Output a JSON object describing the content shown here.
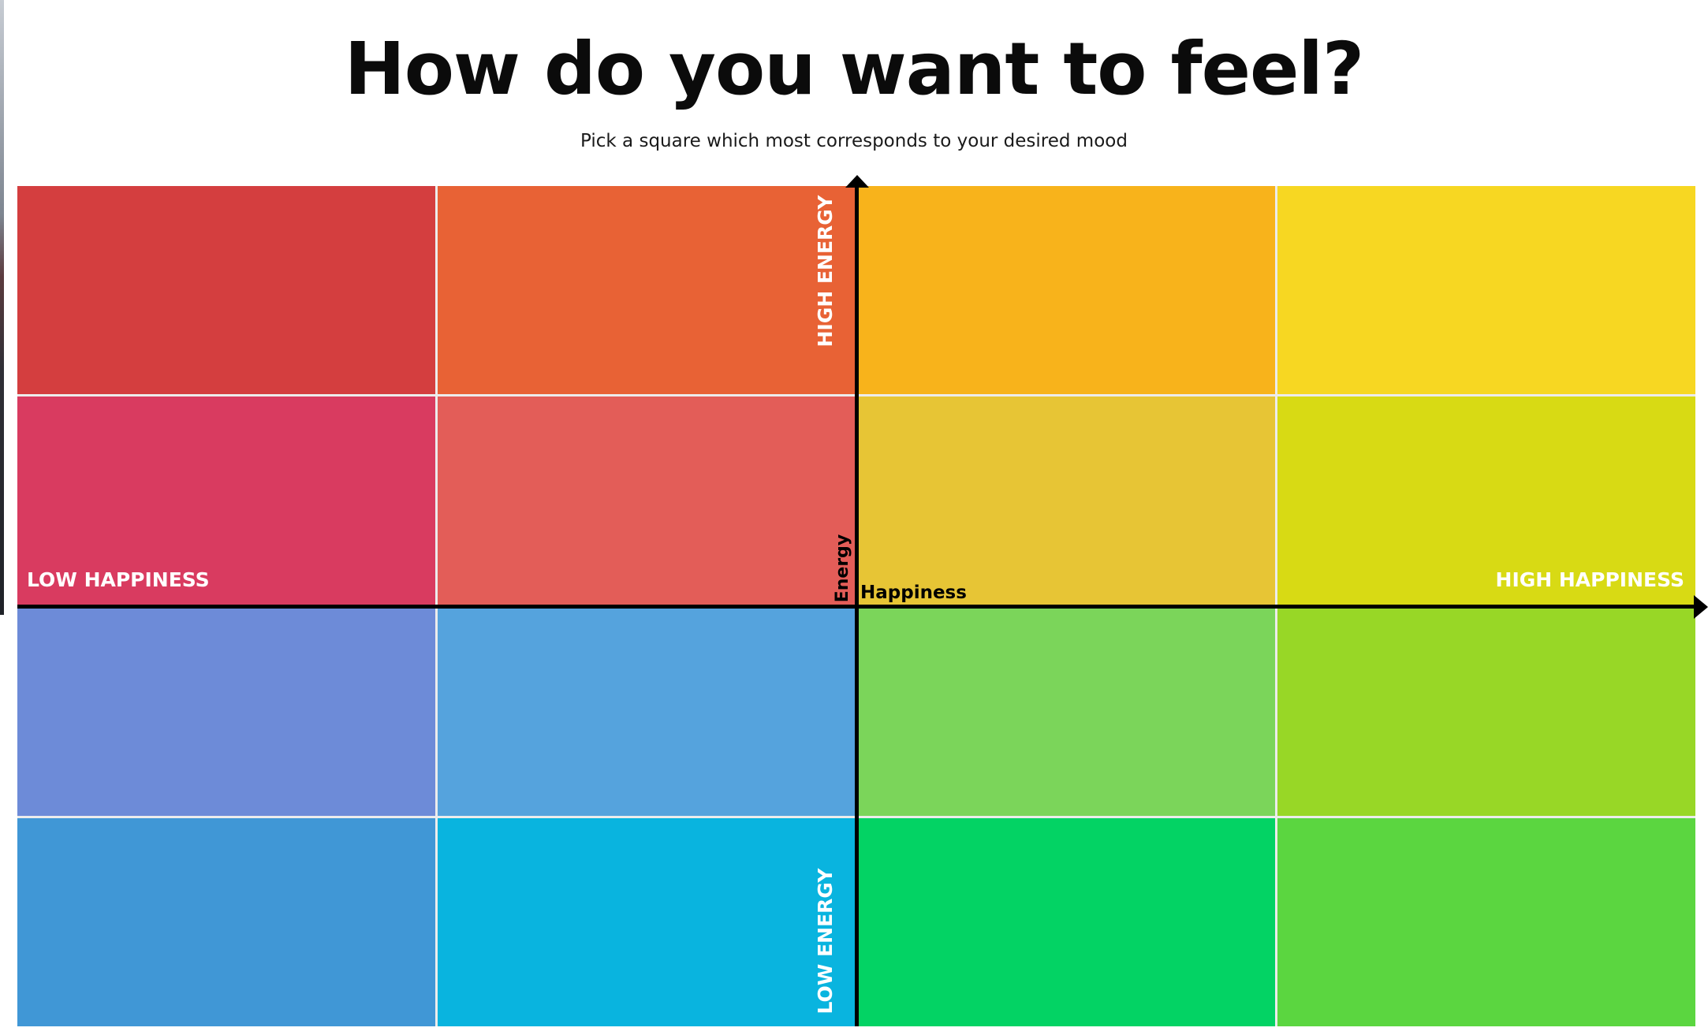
{
  "title": "How do you want to feel?",
  "subtitle": "Pick a square which most corresponds to your desired mood",
  "axes": {
    "horizontal_label": "Happiness",
    "vertical_label": "Energy",
    "low_happiness": "LOW HAPPINESS",
    "high_happiness": "HIGH HAPPINESS",
    "high_energy": "HIGH ENERGY",
    "low_energy": "LOW ENERGY",
    "axis_color": "#000000"
  },
  "grid": {
    "rows": 4,
    "columns": 4,
    "cells": [
      {
        "row": 1,
        "col": 1,
        "color": "#d43e3f"
      },
      {
        "row": 1,
        "col": 2,
        "color": "#e86235"
      },
      {
        "row": 1,
        "col": 3,
        "color": "#f8b31b"
      },
      {
        "row": 1,
        "col": 4,
        "color": "#f7d722"
      },
      {
        "row": 2,
        "col": 1,
        "color": "#d93b60"
      },
      {
        "row": 2,
        "col": 2,
        "color": "#e35d58"
      },
      {
        "row": 2,
        "col": 3,
        "color": "#e7c535"
      },
      {
        "row": 2,
        "col": 4,
        "color": "#d8da14"
      },
      {
        "row": 3,
        "col": 1,
        "color": "#6d8bd8"
      },
      {
        "row": 3,
        "col": 2,
        "color": "#55a3dd"
      },
      {
        "row": 3,
        "col": 3,
        "color": "#7bd55a"
      },
      {
        "row": 3,
        "col": 4,
        "color": "#98d726"
      },
      {
        "row": 4,
        "col": 1,
        "color": "#4097d6"
      },
      {
        "row": 4,
        "col": 2,
        "color": "#09b4df"
      },
      {
        "row": 4,
        "col": 3,
        "color": "#03d364"
      },
      {
        "row": 4,
        "col": 4,
        "color": "#5bd640"
      }
    ]
  }
}
